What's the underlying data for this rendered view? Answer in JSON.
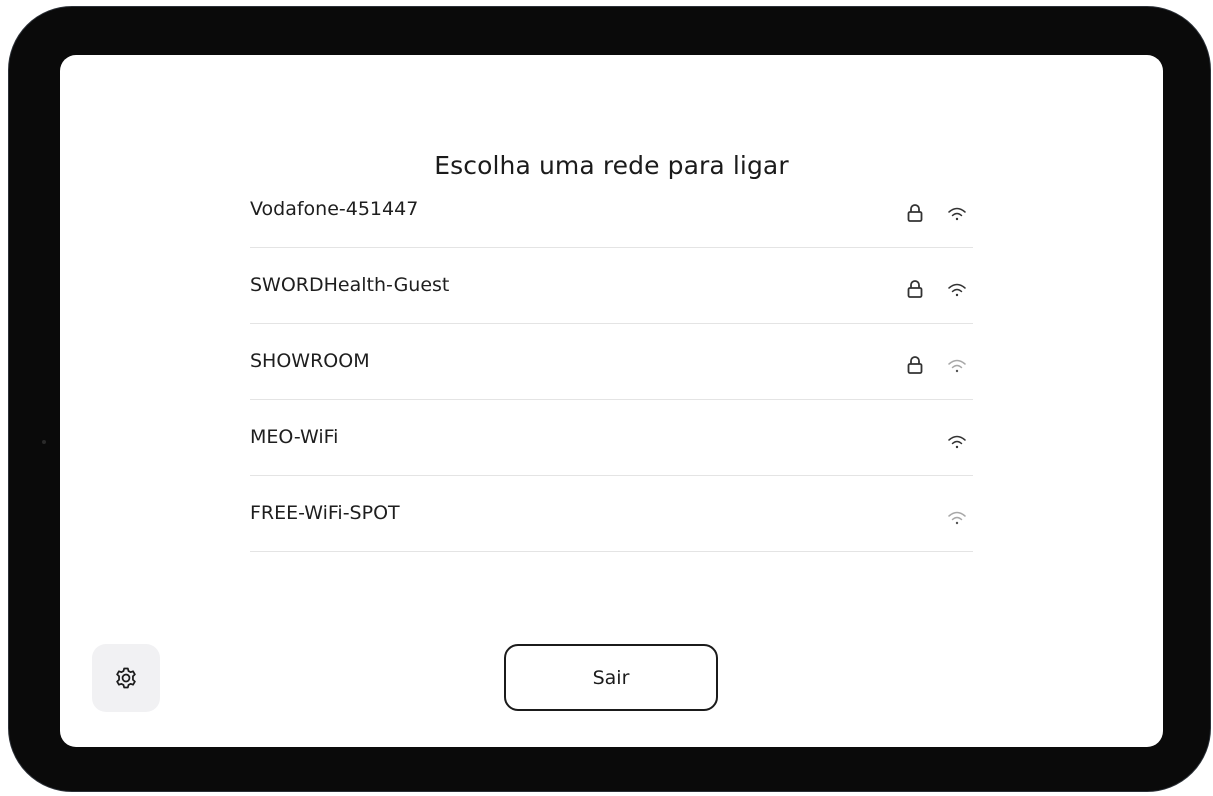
{
  "screen": {
    "title": "Escolha uma rede para ligar"
  },
  "networks": [
    {
      "name": "Vodafone-451447",
      "secured": true,
      "signal": "strong",
      "icons": [
        "lock-icon",
        "wifi-icon"
      ]
    },
    {
      "name": "SWORDHealth-Guest",
      "secured": true,
      "signal": "strong",
      "icons": [
        "lock-icon",
        "wifi-icon"
      ]
    },
    {
      "name": "SHOWROOM",
      "secured": true,
      "signal": "weak",
      "icons": [
        "lock-icon",
        "wifi-icon"
      ]
    },
    {
      "name": "MEO-WiFi",
      "secured": false,
      "signal": "strong",
      "icons": [
        "wifi-icon"
      ]
    },
    {
      "name": "FREE-WiFi-SPOT",
      "secured": false,
      "signal": "weak",
      "icons": [
        "wifi-icon"
      ]
    }
  ],
  "footer": {
    "settings_icon": "gear-icon",
    "exit_label": "Sair"
  },
  "colors": {
    "frame": "#0a0a0a",
    "screen_background": "#ffffff",
    "text": "#1b1b1b",
    "divider": "#e4e4e4",
    "settings_button_background": "#f1f1f3",
    "wifi_strong": "#333333",
    "wifi_weak": "#a8a8a8"
  }
}
